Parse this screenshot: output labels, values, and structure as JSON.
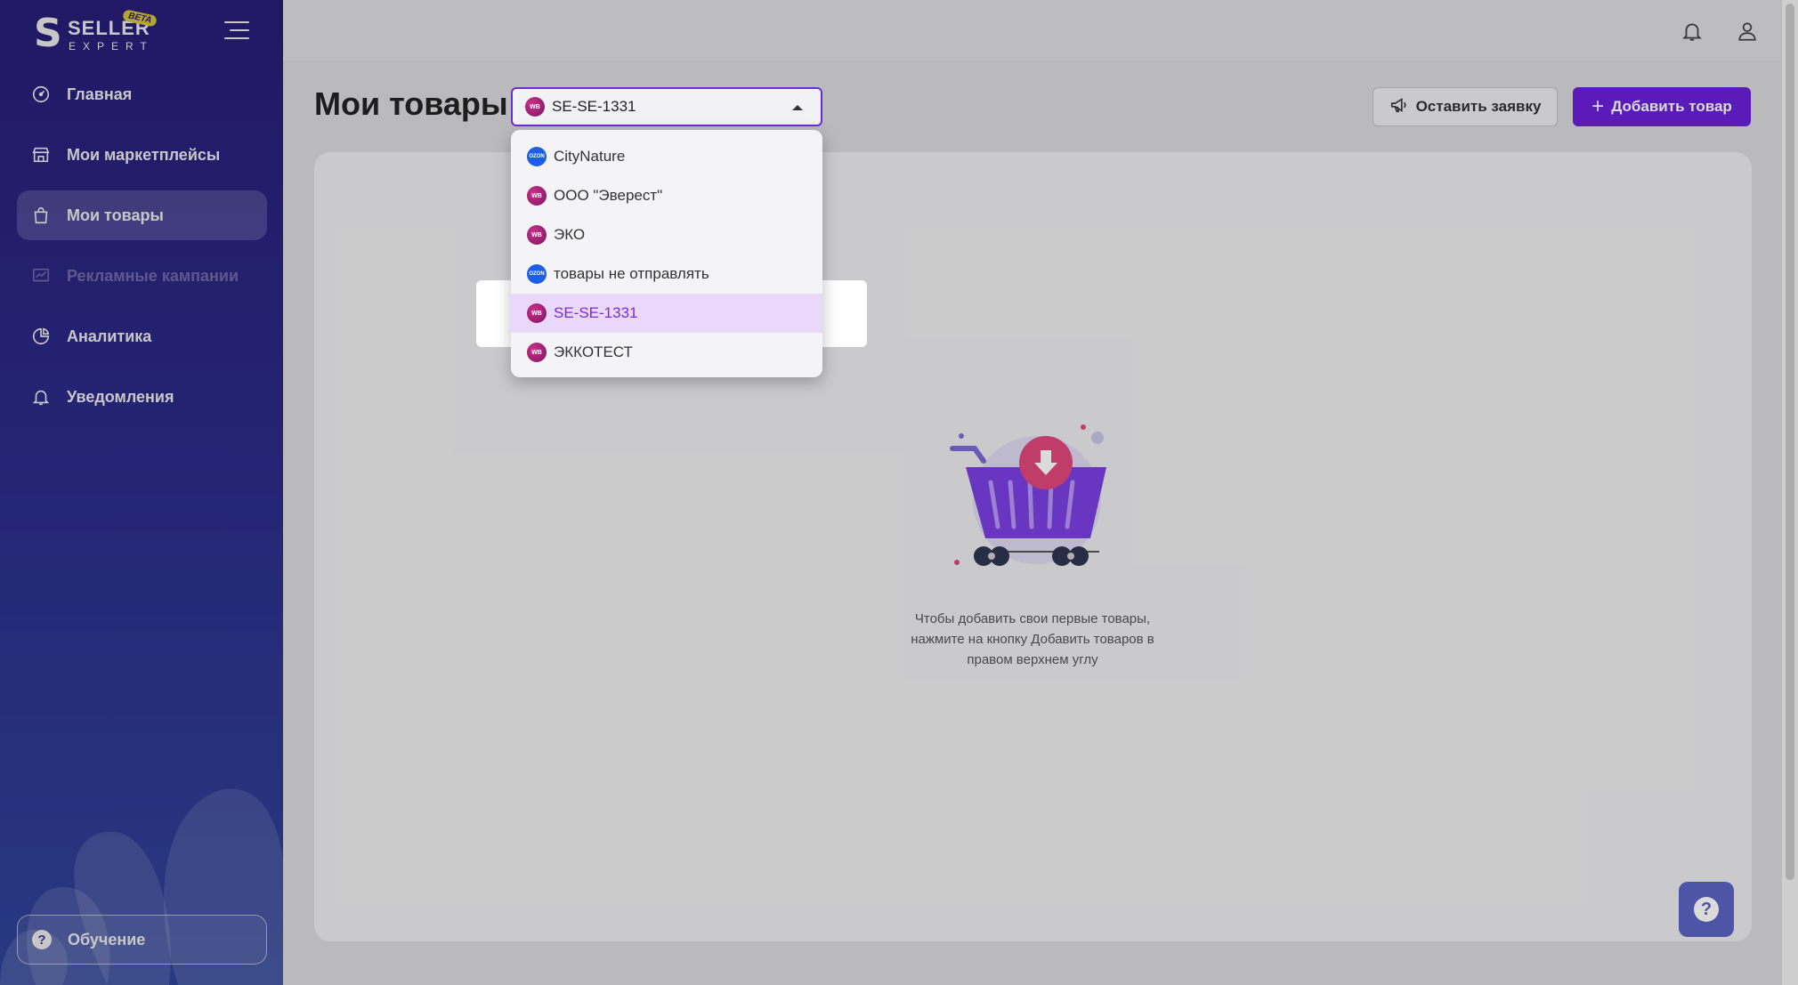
{
  "brand": {
    "logo_letter": "S",
    "name": "SELLER",
    "subname": "EXPERT",
    "badge": "BETA"
  },
  "sidebar": {
    "items": [
      {
        "label": "Главная",
        "icon": "dashboard-icon",
        "state": "normal"
      },
      {
        "label": "Мои маркетплейсы",
        "icon": "store-icon",
        "state": "normal"
      },
      {
        "label": "Мои товары",
        "icon": "bag-icon",
        "state": "active"
      },
      {
        "label": "Рекламные кампании",
        "icon": "chart-icon",
        "state": "disabled"
      },
      {
        "label": "Аналитика",
        "icon": "pie-icon",
        "state": "normal"
      },
      {
        "label": "Уведомления",
        "icon": "bell-icon",
        "state": "normal"
      }
    ],
    "training_label": "Обучение"
  },
  "header": {
    "page_title": "Мои товары",
    "store_select": {
      "value": "SE-SE-1331",
      "marketplace": "WB"
    },
    "request_button": "Оставить заявку",
    "add_button": "Добавить товар"
  },
  "dropdown": {
    "options": [
      {
        "label": "CityNature",
        "marketplace": "OZON"
      },
      {
        "label": "ООО \"Эверест\"",
        "marketplace": "WB"
      },
      {
        "label": "ЭКО",
        "marketplace": "WB"
      },
      {
        "label": "товары не отправлять",
        "marketplace": "OZON"
      },
      {
        "label": "SE-SE-1331",
        "marketplace": "WB",
        "selected": true
      },
      {
        "label": "ЭККОТЕСТ",
        "marketplace": "WB"
      }
    ]
  },
  "empty_state": {
    "line1": "Чтобы добавить свои первые товары,",
    "line2": "нажмите на кнопку Добавить товаров в",
    "line3": "правом верхнем углу"
  },
  "colors": {
    "primary": "#6a1fd9",
    "sidebar_top": "#2c1f82",
    "sidebar_bottom": "#334aa6",
    "selected_bg": "#ead8fb",
    "selected_text": "#7b2bd6",
    "wb_badge": "#b0237a",
    "ozon_badge": "#1a5fe6"
  },
  "help_fab_label": "?"
}
